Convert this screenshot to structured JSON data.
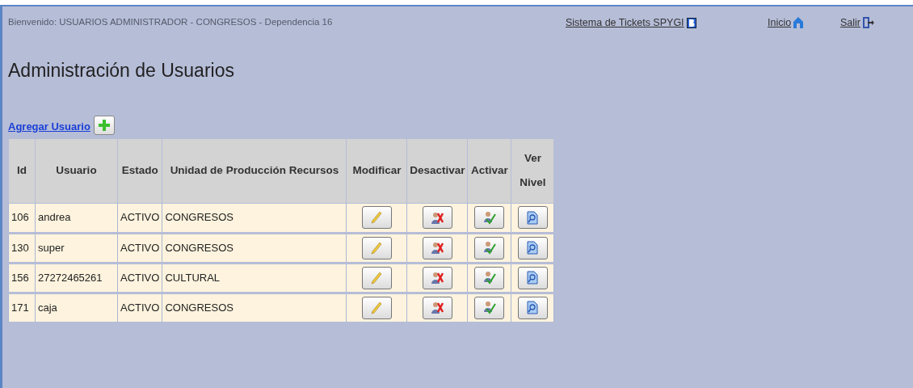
{
  "header": {
    "welcome": "Bienvenido: USUARIOS ADMINISTRADOR - CONGRESOS - Dependencia 16",
    "links": [
      {
        "label": "Sistema de Tickets SPYGI",
        "kind": "tickets"
      },
      {
        "label": "Inicio",
        "kind": "home"
      },
      {
        "label": "Salir",
        "kind": "exit"
      }
    ]
  },
  "title": "Administración de Usuarios",
  "add_link": "Agregar Usuario",
  "table": {
    "columns": [
      {
        "label": "Id",
        "kind": "text"
      },
      {
        "label": "Usuario",
        "kind": "text"
      },
      {
        "label": "Estado",
        "kind": "text"
      },
      {
        "label": "Unidad de Producción Recursos",
        "kind": "text"
      },
      {
        "label": "Modificar",
        "kind": "edit"
      },
      {
        "label": "Desactivar",
        "kind": "deactivate"
      },
      {
        "label": "Activar",
        "kind": "activate"
      },
      {
        "label": "Ver Nivel",
        "kind": "view"
      }
    ],
    "rows": [
      [
        "106",
        "andrea",
        "ACTIVO",
        "CONGRESOS"
      ],
      [
        "130",
        "super",
        "ACTIVO",
        "CONGRESOS"
      ],
      [
        "156",
        "27272465261",
        "ACTIVO",
        "CULTURAL"
      ],
      [
        "171",
        "caja",
        "ACTIVO",
        "CONGRESOS"
      ]
    ]
  }
}
